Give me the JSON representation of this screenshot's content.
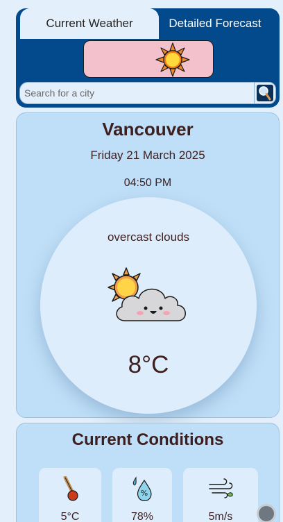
{
  "tabs": [
    {
      "label": "Current Weather",
      "active": true
    },
    {
      "label": "Detailed Forecast",
      "active": false
    }
  ],
  "theme_toggle": {
    "icon": "sun-icon",
    "color": "#f3c1cc"
  },
  "search": {
    "placeholder": "Search for a city",
    "value": ""
  },
  "current": {
    "city": "Vancouver",
    "date": "Friday 21 March 2025",
    "time": "04:50 PM",
    "description": "overcast clouds",
    "icon": "cloud-with-sun-icon",
    "temperature": "8°C"
  },
  "conditions": {
    "title": "Current Conditions",
    "items": [
      {
        "icon": "thermometer-icon",
        "value": "5°C"
      },
      {
        "icon": "humidity-icon",
        "value": "78%"
      },
      {
        "icon": "wind-icon",
        "value": "5m/s"
      }
    ]
  },
  "colors": {
    "header": "#024a8c",
    "card": "#bfdff8",
    "background": "#e3f0fb",
    "text": "#3d1f1f"
  }
}
